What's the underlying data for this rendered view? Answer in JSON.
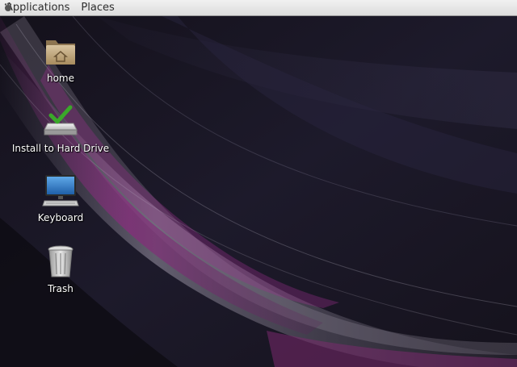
{
  "top_panel": {
    "menus": [
      {
        "label": "Applications"
      },
      {
        "label": "Places"
      }
    ]
  },
  "desktop": {
    "icons": [
      {
        "label": "home",
        "icon": "folder-home-icon"
      },
      {
        "label": "Install to Hard Drive",
        "icon": "install-drive-icon"
      },
      {
        "label": "Keyboard",
        "icon": "monitor-keyboard-icon"
      },
      {
        "label": "Trash",
        "icon": "trash-icon"
      }
    ]
  },
  "colors": {
    "panel_bg": "#e6e6e6",
    "wallpaper_base": "#17141f",
    "wallpaper_accent": "#7a2a6e"
  }
}
